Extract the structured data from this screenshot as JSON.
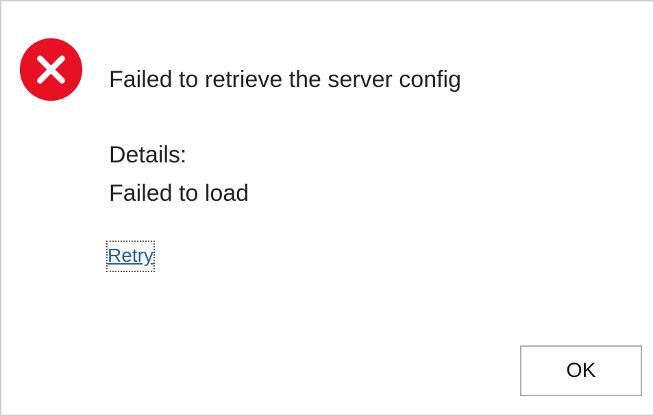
{
  "dialog": {
    "icon": "error-icon",
    "message": "Failed to retrieve the server config",
    "details_label": "Details:",
    "details_text": "Failed to load",
    "retry_link": "Retry",
    "ok_button": "OK"
  },
  "colors": {
    "error_red": "#e81123",
    "link_blue": "#1f5fa8",
    "text": "#222222",
    "border": "#cdcdcd"
  }
}
